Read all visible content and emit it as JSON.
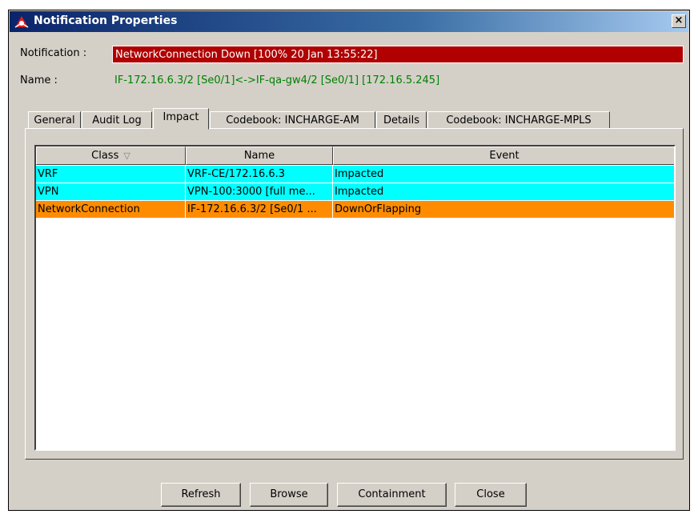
{
  "window": {
    "title": "Notification Properties",
    "close_glyph": "×"
  },
  "notification": {
    "label": "Notification :",
    "value": "NetworkConnection Down  [100% 20 Jan 13:55:22]"
  },
  "name": {
    "label": "Name :",
    "value": "IF-172.16.6.3/2 [Se0/1]<->IF-qa-gw4/2 [Se0/1] [172.16.5.245]"
  },
  "tabs": [
    {
      "label": "General"
    },
    {
      "label": "Audit Log"
    },
    {
      "label": "Impact"
    },
    {
      "label": "Codebook: INCHARGE-AM"
    },
    {
      "label": "Details"
    },
    {
      "label": "Codebook: INCHARGE-MPLS"
    }
  ],
  "active_tab": "Impact",
  "table": {
    "columns": [
      {
        "label": "Class",
        "sort_icon": "▽"
      },
      {
        "label": "Name"
      },
      {
        "label": "Event"
      }
    ],
    "rows": [
      {
        "class": "VRF",
        "name": "VRF-CE/172.16.6.3",
        "event": "Impacted",
        "color": "#00ffff"
      },
      {
        "class": "VPN",
        "name": "VPN-100:3000 [full me...",
        "event": "Impacted",
        "color": "#00ffff"
      },
      {
        "class": "NetworkConnection",
        "name": "IF-172.16.6.3/2 [Se0/1 ...",
        "event": "DownOrFlapping",
        "color": "#ff8c00"
      }
    ]
  },
  "buttons": {
    "refresh": "Refresh",
    "browse": "Browse",
    "containment": "Containment",
    "close": "Close"
  },
  "colors": {
    "notification_bg": "#b00000",
    "name_text": "#008000",
    "impacted_row": "#00ffff",
    "down_row": "#ff8c00"
  }
}
